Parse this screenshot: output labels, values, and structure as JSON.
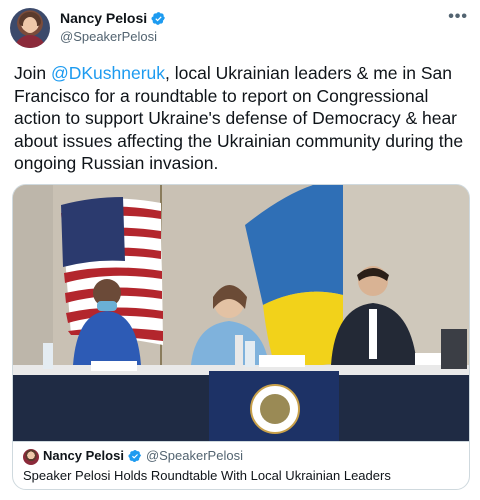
{
  "header": {
    "name": "Nancy Pelosi",
    "handle": "@SpeakerPelosi",
    "more_label": "•••"
  },
  "tweet": {
    "text_before": "Join ",
    "mention": "@DKushneruk",
    "text_after": ", local Ukrainian leaders & me in San Francisco for a roundtable to report on Congressional action to support Ukraine's defense of Democracy & hear about issues affecting the Ukrainian community during the ongoing Russian invasion."
  },
  "card": {
    "author_name": "Nancy Pelosi",
    "author_handle": "@SpeakerPelosi",
    "title": "Speaker Pelosi Holds Roundtable With Local Ukrainian Leaders"
  },
  "colors": {
    "accent": "#1d9bf0",
    "secondary_text": "#536471",
    "border": "#cfd9de"
  },
  "icons": {
    "verified": "verified-badge-icon",
    "more": "more-options-icon"
  }
}
